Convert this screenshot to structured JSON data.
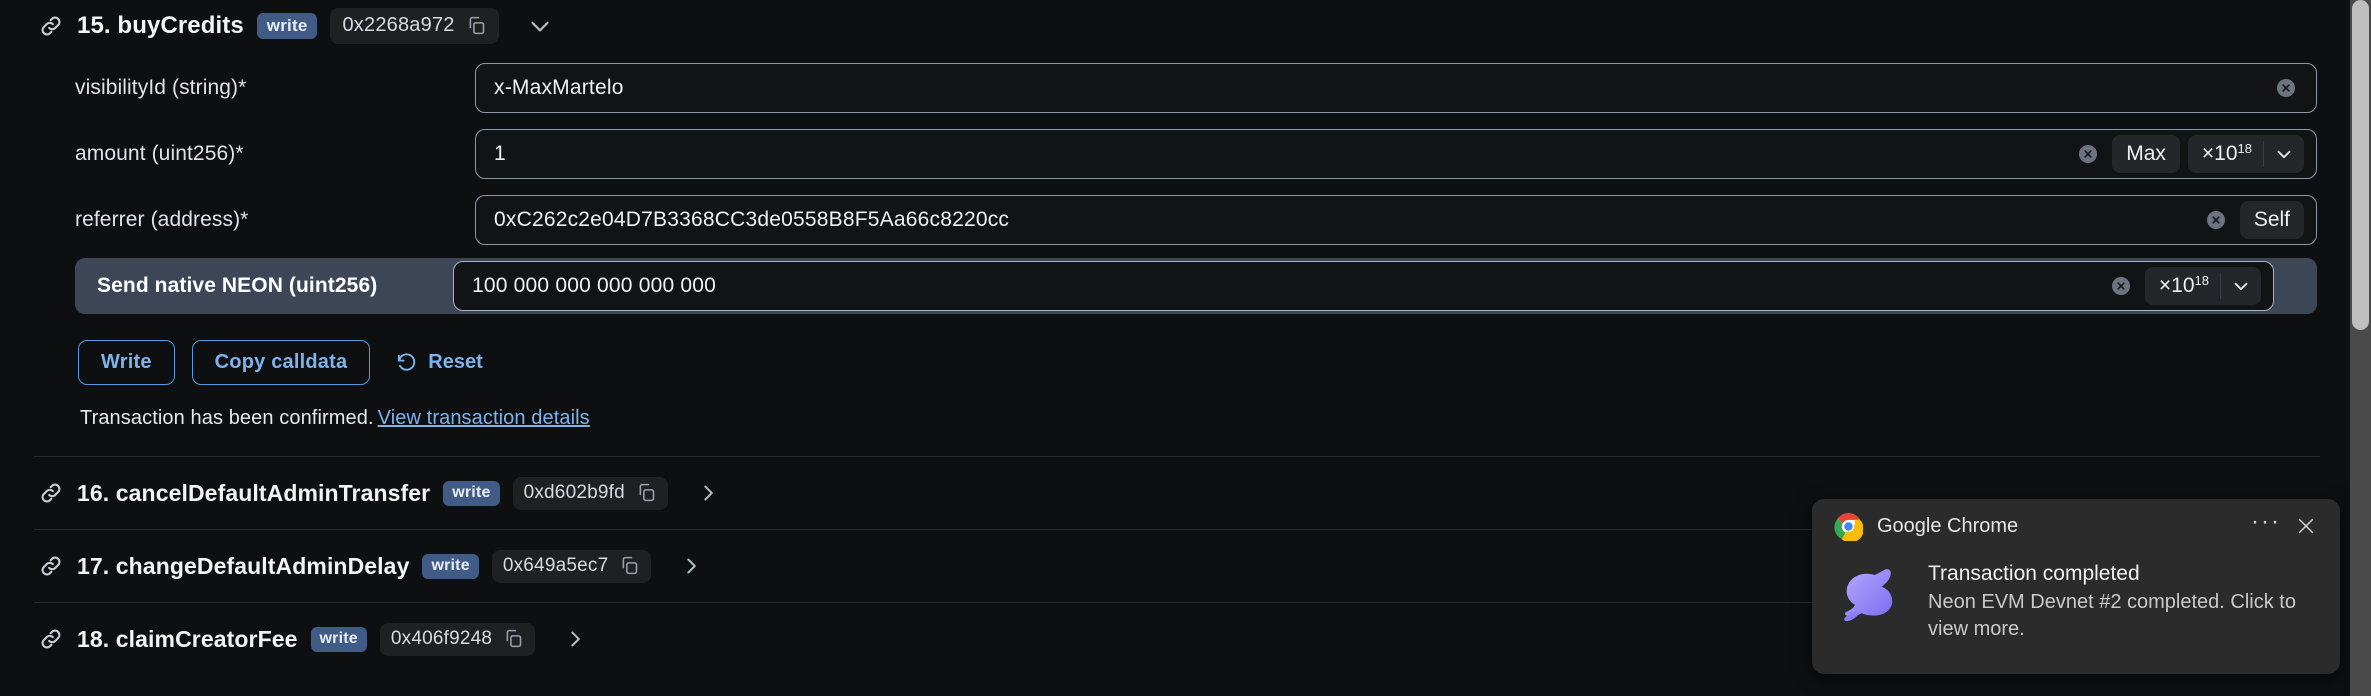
{
  "expanded_function": {
    "index_label": "15. buyCredits",
    "mutability_badge": "write",
    "selector": "0x2268a972",
    "copy_icon": "copy-icon",
    "link_icon": "link-icon",
    "collapse_icon": "chevron-down-icon"
  },
  "parameters": [
    {
      "label": "visibilityId (string)*",
      "value": "x-MaxMartelo",
      "clear_icon": "clear-circle-icon",
      "adornments": [],
      "highlighted": false
    },
    {
      "label": "amount (uint256)*",
      "value": "1",
      "clear_icon": "clear-circle-icon",
      "adornments": [
        "Max",
        "×10"
      ],
      "exponent": "18",
      "highlighted": false
    },
    {
      "label": "referrer (address)*",
      "value": "0xC262c2e04D7B3368CC3de0558B8F5Aa66c8220cc",
      "clear_icon": "clear-circle-icon",
      "adornments": [
        "Self"
      ],
      "highlighted": false
    },
    {
      "label": "Send native NEON (uint256)",
      "value": "100 000 000 000 000 000",
      "clear_icon": "clear-circle-icon",
      "adornments": [
        "×10"
      ],
      "exponent": "18",
      "highlighted": true
    }
  ],
  "actions": {
    "write_label": "Write",
    "copy_calldata_label": "Copy calldata",
    "reset_label": "Reset",
    "reset_icon": "reset-arrow-icon"
  },
  "status": {
    "text": "Transaction has been confirmed.",
    "link_text": "View transaction details"
  },
  "function_list": [
    {
      "name": "16. cancelDefaultAdminTransfer",
      "badge": "write",
      "selector": "0xd602b9fd",
      "expand_icon": "chevron-right-icon"
    },
    {
      "name": "17. changeDefaultAdminDelay",
      "badge": "write",
      "selector": "0x649a5ec7",
      "expand_icon": "chevron-right-icon"
    },
    {
      "name": "18. claimCreatorFee",
      "badge": "write",
      "selector": "0x406f9248",
      "expand_icon": "chevron-right-icon"
    }
  ],
  "toast": {
    "app_name": "Google Chrome",
    "app_icon": "chrome-logo-icon",
    "more_icon": "more-options-icon",
    "close_icon": "close-icon",
    "thumbnail_icon": "neon-rabbit-icon",
    "title": "Transaction completed",
    "description": "Neon EVM Devnet #2 completed. Click to view more."
  },
  "colors": {
    "page_bg": "#0d0f11",
    "accent_link": "#7db3ec",
    "badge_write_bg": "#3f5b86",
    "highlight_row_bg": "#3c4657",
    "toast_bg": "#2b2b2b"
  }
}
